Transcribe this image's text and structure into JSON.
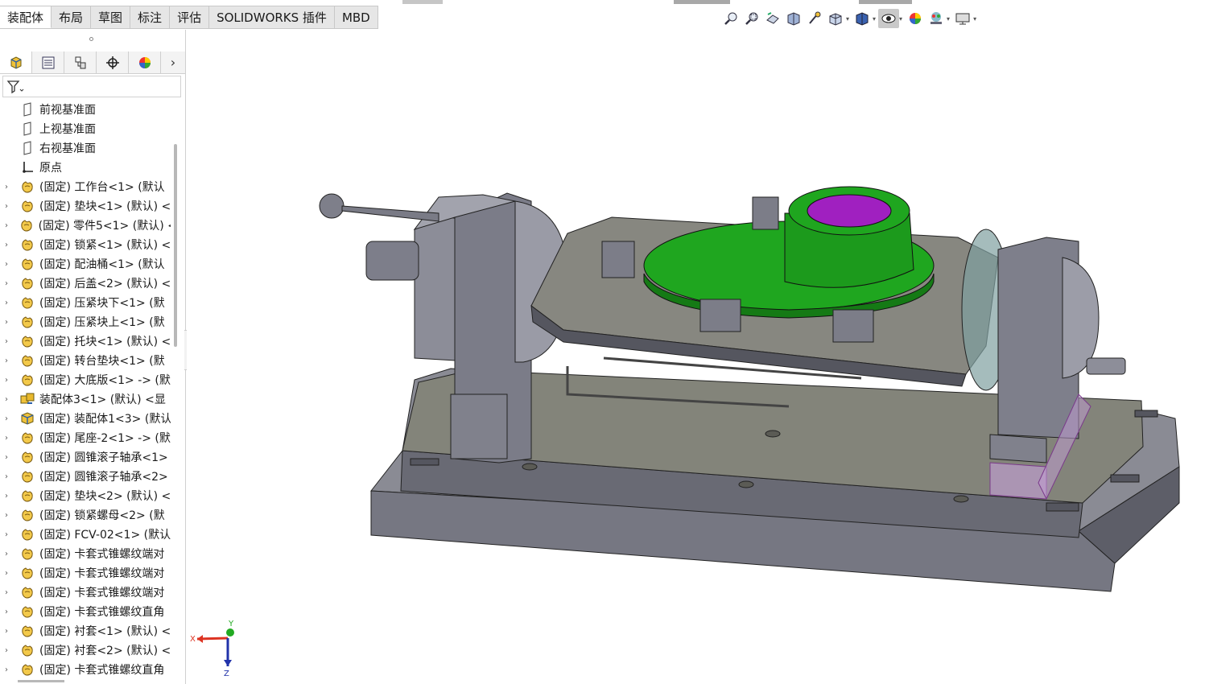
{
  "tabs": [
    {
      "label": "装配体",
      "active": true
    },
    {
      "label": "布局",
      "active": false
    },
    {
      "label": "草图",
      "active": false
    },
    {
      "label": "标注",
      "active": false
    },
    {
      "label": "评估",
      "active": false
    },
    {
      "label": "SOLIDWORKS 插件",
      "active": false
    },
    {
      "label": "MBD",
      "active": false
    }
  ],
  "manager_tabs": [
    "featuremanager-icon",
    "propertymanager-icon",
    "configurationmanager-icon",
    "dimxpert-icon",
    "display-manager-icon"
  ],
  "tree": [
    {
      "label": "前视基准面",
      "icon": "plane-icon",
      "expandable": false
    },
    {
      "label": "上视基准面",
      "icon": "plane-icon",
      "expandable": false
    },
    {
      "label": "右视基准面",
      "icon": "plane-icon",
      "expandable": false
    },
    {
      "label": "原点",
      "icon": "origin-icon",
      "expandable": false
    },
    {
      "label": "(固定) 工作台<1> (默认",
      "icon": "part-icon",
      "expandable": true
    },
    {
      "label": "(固定) 垫块<1> (默认) <",
      "icon": "part-icon",
      "expandable": true
    },
    {
      "label": "(固定) 零件5<1> (默认) <",
      "icon": "part-icon",
      "expandable": true
    },
    {
      "label": "(固定) 锁紧<1> (默认) <",
      "icon": "part-icon",
      "expandable": true
    },
    {
      "label": "(固定) 配油桶<1> (默认",
      "icon": "part-icon",
      "expandable": true
    },
    {
      "label": "(固定) 后盖<2> (默认) <",
      "icon": "part-icon",
      "expandable": true
    },
    {
      "label": "(固定) 压紧块下<1> (默",
      "icon": "part-icon",
      "expandable": true
    },
    {
      "label": "(固定) 压紧块上<1> (默",
      "icon": "part-icon",
      "expandable": true
    },
    {
      "label": "(固定) 托块<1> (默认) <",
      "icon": "part-icon",
      "expandable": true
    },
    {
      "label": "(固定) 转台垫块<1> (默",
      "icon": "part-icon",
      "expandable": true
    },
    {
      "label": "(固定) 大底版<1> -> (默",
      "icon": "part-icon",
      "expandable": true
    },
    {
      "label": "装配体3<1> (默认) <显",
      "icon": "subassembly-icon",
      "expandable": true
    },
    {
      "label": "(固定) 装配体1<3> (默认",
      "icon": "assembly-icon",
      "expandable": true
    },
    {
      "label": "(固定) 尾座-2<1> -> (默",
      "icon": "part-icon",
      "expandable": true
    },
    {
      "label": "(固定) 圆锥滚子轴承<1>",
      "icon": "part-icon",
      "expandable": true
    },
    {
      "label": "(固定) 圆锥滚子轴承<2>",
      "icon": "part-icon",
      "expandable": true
    },
    {
      "label": "(固定) 垫块<2> (默认) <",
      "icon": "part-icon",
      "expandable": true
    },
    {
      "label": "(固定) 锁紧螺母<2> (默",
      "icon": "part-icon",
      "expandable": true
    },
    {
      "label": "(固定) FCV-02<1> (默认",
      "icon": "part-icon",
      "expandable": true
    },
    {
      "label": "(固定) 卡套式锥螺纹端对",
      "icon": "part-icon",
      "expandable": true
    },
    {
      "label": "(固定) 卡套式锥螺纹端对",
      "icon": "part-icon",
      "expandable": true
    },
    {
      "label": "(固定) 卡套式锥螺纹端对",
      "icon": "part-icon",
      "expandable": true
    },
    {
      "label": "(固定) 卡套式锥螺纹直角",
      "icon": "part-icon",
      "expandable": true
    },
    {
      "label": "(固定) 衬套<1> (默认) <",
      "icon": "part-icon",
      "expandable": true
    },
    {
      "label": "(固定) 衬套<2> (默认) <",
      "icon": "part-icon",
      "expandable": true
    },
    {
      "label": "(固定) 卡套式锥螺纹直角",
      "icon": "part-icon",
      "expandable": true
    }
  ],
  "hud_buttons": [
    "zoom-to-fit-icon",
    "zoom-to-area-icon",
    "previous-view-icon",
    "section-view-icon",
    "dynamic-annotation-icon",
    "view-orientation-icon",
    "display-style-icon",
    "hide-show-items-icon",
    "edit-appearance-icon",
    "apply-scene-icon",
    "view-settings-icon"
  ],
  "triad": {
    "x": "X",
    "y": "Y",
    "z": "Z"
  },
  "colors": {
    "part_gray": "#8a8b94",
    "green_part": "#1fa61f",
    "magenta_inner": "#a020c0",
    "tab_active": "#ffffff"
  }
}
